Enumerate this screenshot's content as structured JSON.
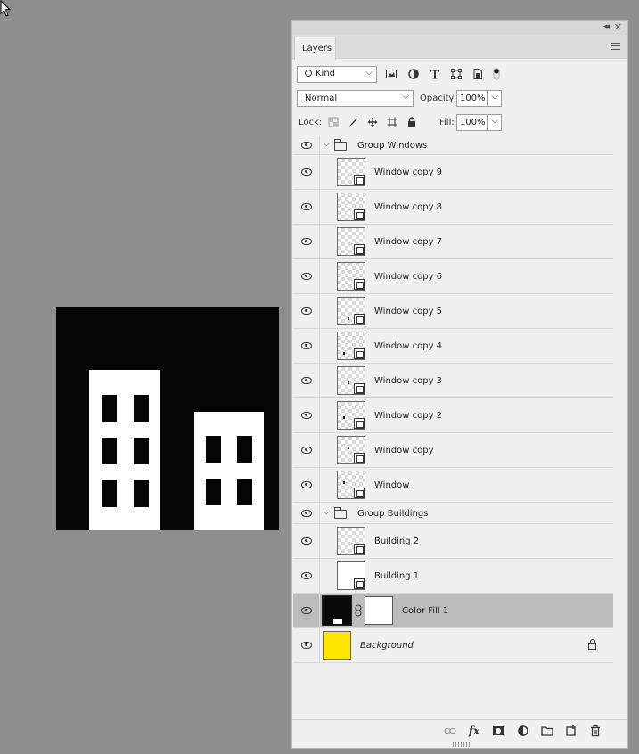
{
  "panel": {
    "tab_label": "Layers",
    "icons": {
      "collapse": "double-chevron-left-icon",
      "close": "close-icon",
      "menu": "panel-menu-icon"
    }
  },
  "filter": {
    "kind_label": "Kind",
    "filter_icons": [
      "pixel-filter-icon",
      "adjustment-filter-icon",
      "type-filter-icon",
      "shape-filter-icon",
      "smart-object-filter-icon",
      "filter-toggle-icon"
    ]
  },
  "blend": {
    "mode": "Normal",
    "opacity_label": "Opacity:",
    "opacity_value": "100%"
  },
  "lock": {
    "label": "Lock:",
    "fill_label": "Fill:",
    "fill_value": "100%"
  },
  "layers": [
    {
      "name": "Group Windows",
      "type": "group"
    },
    {
      "name": "Window copy 9",
      "type": "shape"
    },
    {
      "name": "Window copy 8",
      "type": "shape"
    },
    {
      "name": "Window copy 7",
      "type": "shape"
    },
    {
      "name": "Window copy 6",
      "type": "shape"
    },
    {
      "name": "Window copy 5",
      "type": "shape"
    },
    {
      "name": "Window copy 4",
      "type": "shape"
    },
    {
      "name": "Window copy 3",
      "type": "shape"
    },
    {
      "name": "Window copy 2",
      "type": "shape"
    },
    {
      "name": "Window copy",
      "type": "shape"
    },
    {
      "name": "Window",
      "type": "shape"
    },
    {
      "name": "Group Buildings",
      "type": "group"
    },
    {
      "name": "Building 2",
      "type": "shape"
    },
    {
      "name": "Building 1",
      "type": "shape"
    },
    {
      "name": "Color Fill 1",
      "type": "fill",
      "selected": true
    },
    {
      "name": "Background",
      "type": "background",
      "color": "#ffe600",
      "locked": true
    }
  ],
  "bottom_icons": [
    "link-layers-icon",
    "fx-icon",
    "add-mask-icon",
    "adjustment-layer-icon",
    "new-group-icon",
    "new-layer-icon",
    "trash-icon"
  ],
  "bottom_fx_label": "fx",
  "colors": {
    "canvas_bg": "#050505",
    "building": "#ffffff",
    "background_layer": "#ffe600",
    "selected_row": "#bcbcbc"
  }
}
